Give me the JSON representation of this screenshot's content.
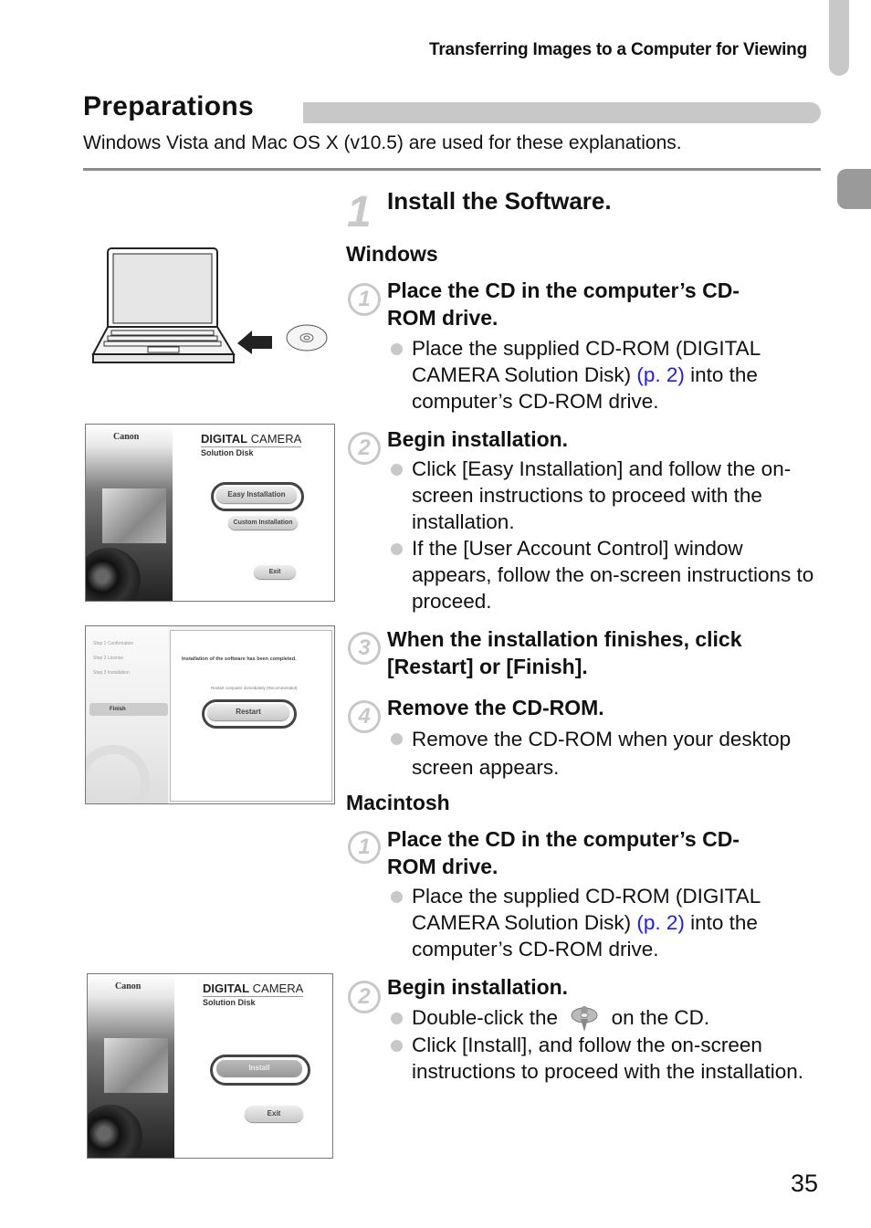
{
  "header": {
    "chapter_title": "Transferring Images to a Computer for Viewing"
  },
  "section": {
    "title": "Preparations",
    "intro": "Windows Vista and Mac OS X (v10.5) are used for these explanations."
  },
  "step": {
    "number": "1",
    "title": "Install the Software."
  },
  "windows": {
    "heading": "Windows",
    "substeps": [
      {
        "number": "1",
        "title_line1": "Place the CD in the computer’s CD-",
        "title_line2": "ROM drive.",
        "bullets": [
          {
            "before": "Place the supplied CD-ROM (DIGITAL CAMERA Solution Disk) ",
            "link": "(p. 2)",
            "after": " into the computer’s CD-ROM drive."
          }
        ]
      },
      {
        "number": "2",
        "title_line1": "Begin installation.",
        "bullets": [
          {
            "text": "Click [Easy Installation] and follow the on-screen instructions to proceed with the installation."
          },
          {
            "text": "If the [User Account Control] window appears, follow the on-screen instructions to proceed."
          }
        ]
      },
      {
        "number": "3",
        "title_line1": "When the installation finishes, click",
        "title_line2": "[Restart] or [Finish]."
      },
      {
        "number": "4",
        "title_line1": "Remove the CD-ROM.",
        "bullets": [
          {
            "text": "Remove the CD-ROM when your desktop screen appears."
          }
        ]
      }
    ]
  },
  "macintosh": {
    "heading": "Macintosh",
    "substeps": [
      {
        "number": "1",
        "title_line1": "Place the CD in the computer’s CD-",
        "title_line2": "ROM drive.",
        "bullets": [
          {
            "before": "Place the supplied CD-ROM (DIGITAL CAMERA Solution Disk) ",
            "link": "(p. 2)",
            "after": " into the computer’s CD-ROM drive."
          }
        ]
      },
      {
        "number": "2",
        "title_line1": "Begin installation.",
        "bullets": [
          {
            "before": "Double-click the ",
            "icon": "installer-icon",
            "after": " on the CD."
          },
          {
            "text": "Click [Install], and follow the on-screen instructions to proceed with the installation."
          }
        ]
      }
    ]
  },
  "screens": {
    "win_menu": {
      "brand": "Canon",
      "title_bold": "DIGITAL",
      "title_rest": " CAMERA",
      "subtitle": "Solution Disk",
      "buttons": [
        "Easy Installation",
        "Custom Installation",
        "Exit"
      ],
      "highlighted": "Easy Installation"
    },
    "win_finish": {
      "steps": [
        "Step 1  Confirmation",
        "Step 2  License",
        "Step 3  Installation",
        "Finish"
      ],
      "message": "Installation of the software has been completed.",
      "checkbox": "Restart computer immediately (Recommended)",
      "button": "Restart"
    },
    "mac_menu": {
      "brand": "Canon",
      "title_bold": "DIGITAL",
      "title_rest": " CAMERA",
      "subtitle": "Solution Disk",
      "buttons": [
        "Install",
        "Exit"
      ],
      "highlighted": "Install"
    }
  },
  "page_number": "35"
}
